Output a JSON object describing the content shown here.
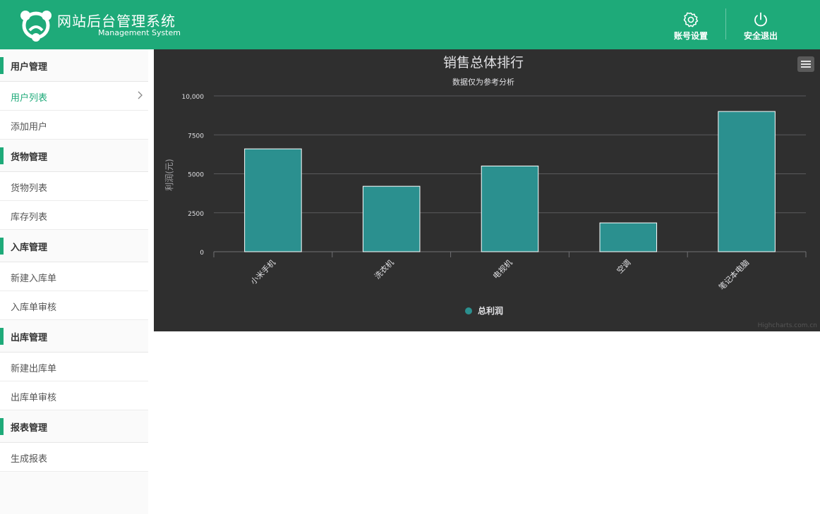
{
  "header": {
    "title": "网站后台管理系统",
    "subtitle": "Management System",
    "actions": [
      {
        "label": "账号设置",
        "icon": "gear-icon"
      },
      {
        "label": "安全退出",
        "icon": "power-icon"
      }
    ],
    "bg_color": "#1eaa79"
  },
  "sidebar": {
    "sections": [
      {
        "title": "用户管理",
        "items": [
          {
            "label": "用户列表",
            "active": true
          },
          {
            "label": "添加用户"
          }
        ]
      },
      {
        "title": "货物管理",
        "items": [
          {
            "label": "货物列表"
          },
          {
            "label": "库存列表"
          }
        ]
      },
      {
        "title": "入库管理",
        "items": [
          {
            "label": "新建入库单"
          },
          {
            "label": "入库单审核"
          }
        ]
      },
      {
        "title": "出库管理",
        "items": [
          {
            "label": "新建出库单"
          },
          {
            "label": "出库单审核"
          }
        ]
      },
      {
        "title": "报表管理",
        "items": [
          {
            "label": "生成报表"
          }
        ]
      }
    ]
  },
  "chart_data": {
    "type": "bar",
    "title": "销售总体排行",
    "subtitle": "数据仅为参考分析",
    "ylabel": "利润(元)",
    "xlabel": "",
    "categories": [
      "小米手机",
      "洗衣机",
      "电视机",
      "空调",
      "笔记本电脑"
    ],
    "series": [
      {
        "name": "总利润",
        "values": [
          6600,
          4200,
          5500,
          1850,
          9000
        ],
        "color": "#2b908f"
      }
    ],
    "ylim": [
      0,
      10000
    ],
    "yticks": [
      "0",
      "2500",
      "5000",
      "7500",
      "10,000"
    ],
    "legend_position": "bottom-center",
    "grid": true,
    "credits": "Highcharts.com.cn",
    "background": "#2f2f2f"
  }
}
